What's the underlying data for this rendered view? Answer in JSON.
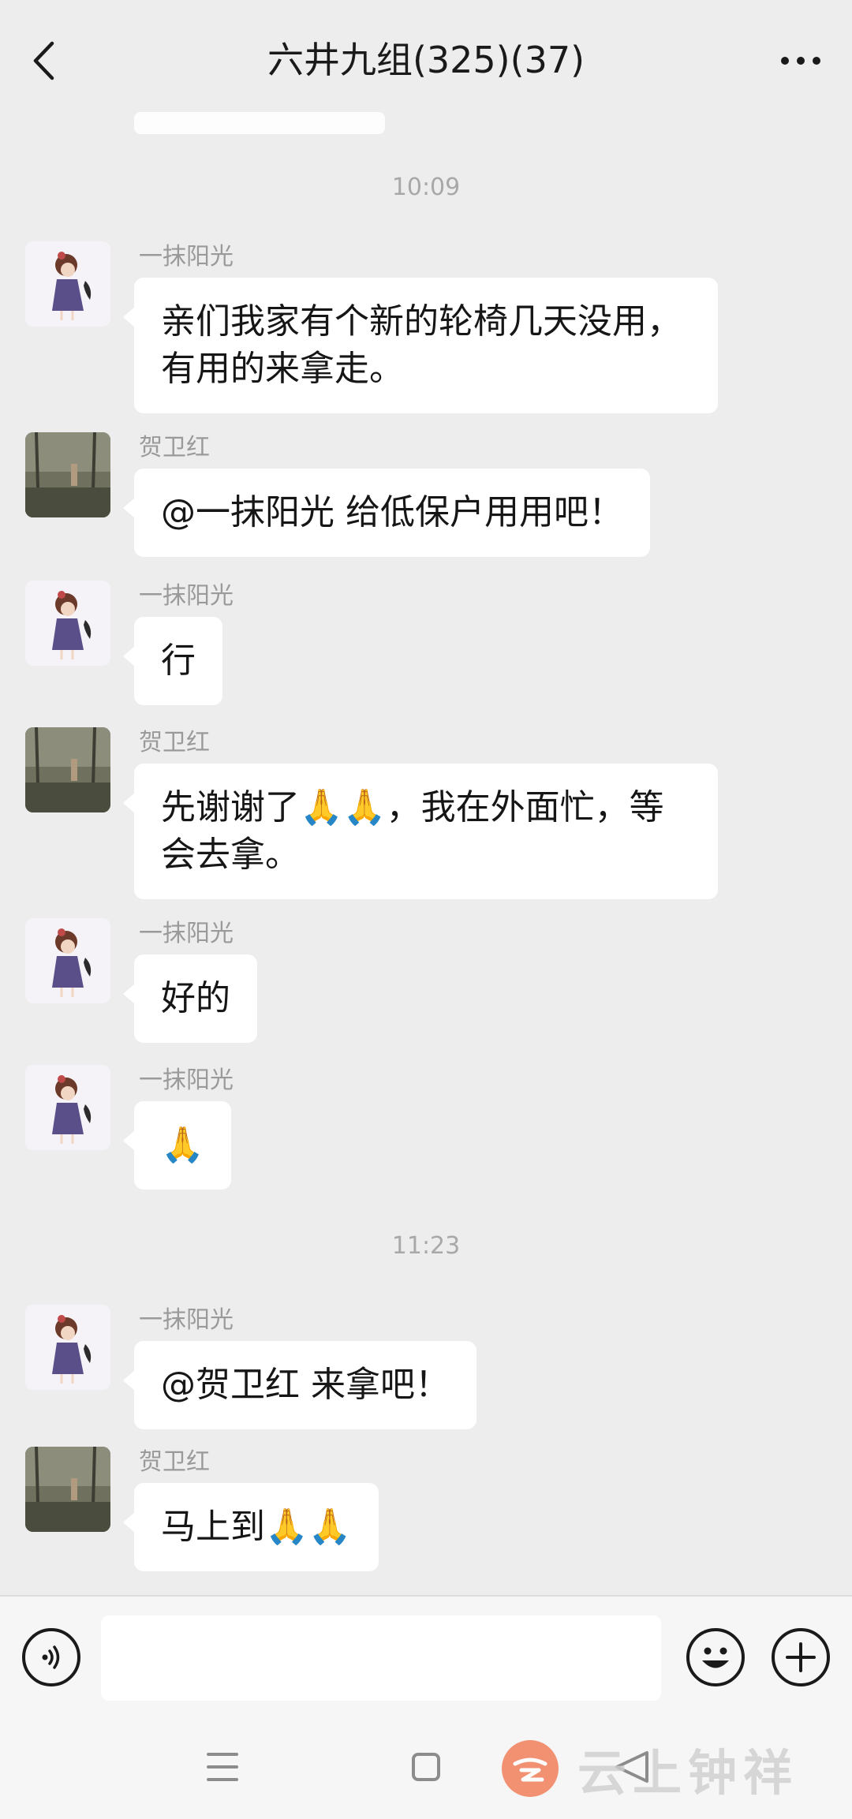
{
  "header": {
    "title": "六井九组(325)(37)"
  },
  "chat": {
    "times": [
      "10:09",
      "11:23"
    ],
    "messages": [
      {
        "sender": "一抹阳光",
        "avatar": "girl-avatar",
        "text": "亲们我家有个新的轮椅几天没用，\n有用的来拿走。"
      },
      {
        "sender": "贺卫红",
        "avatar": "photo-avatar",
        "text": "@一抹阳光  给低保户用用吧！"
      },
      {
        "sender": "一抹阳光",
        "avatar": "girl-avatar",
        "text": "行"
      },
      {
        "sender": "贺卫红",
        "avatar": "photo-avatar",
        "text": "先谢谢了🙏🙏，我在外面忙，等\n会去拿。"
      },
      {
        "sender": "一抹阳光",
        "avatar": "girl-avatar",
        "text": "好的"
      },
      {
        "sender": "一抹阳光",
        "avatar": "girl-avatar",
        "text": "🙏"
      },
      {
        "sender": "一抹阳光",
        "avatar": "girl-avatar",
        "text": "@贺卫红  来拿吧！"
      },
      {
        "sender": "贺卫红",
        "avatar": "photo-avatar",
        "text": "马上到🙏🙏"
      }
    ]
  },
  "input": {
    "value": "",
    "voice_icon": "voice-icon",
    "emoji_icon": "emoji-icon",
    "plus_icon": "plus-icon"
  },
  "watermark": {
    "text": "云上钟祥"
  },
  "colors": {
    "background": "#ededed",
    "bubble": "#ffffff",
    "watermark_logo": "#f07b54"
  }
}
